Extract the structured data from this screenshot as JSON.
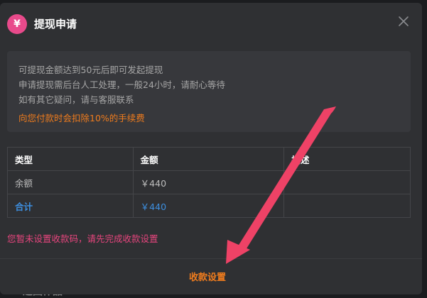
{
  "background": {
    "peek_text": "返回作品"
  },
  "dialog": {
    "title": "提现申请",
    "badge_symbol": "¥",
    "info": {
      "line1": "可提现金额达到50元后即可发起提现",
      "line2": "申请提现需后台人工处理，一般24小时，请耐心等待",
      "line3": "如有其它疑问，请与客服联系",
      "warning": "向您付款时会扣除10%的手续费"
    },
    "table": {
      "headers": {
        "type": "类型",
        "amount": "金额",
        "desc": "描述"
      },
      "rows": [
        {
          "type": "余额",
          "amount": "￥440",
          "desc": ""
        }
      ],
      "total": {
        "type": "合计",
        "amount": "￥440",
        "desc": ""
      }
    },
    "notice": "您暂未设置收款码，请先完成收款设置",
    "footer_button": "收款设置"
  },
  "colors": {
    "modal_bg": "#2f3033",
    "accent_orange": "#f07c1d",
    "notice_pink": "#e8457e",
    "total_blue": "#3d8fe0",
    "annotation_arrow": "#ee4266"
  },
  "icons": {
    "badge": "yen-icon",
    "close": "close-icon"
  }
}
